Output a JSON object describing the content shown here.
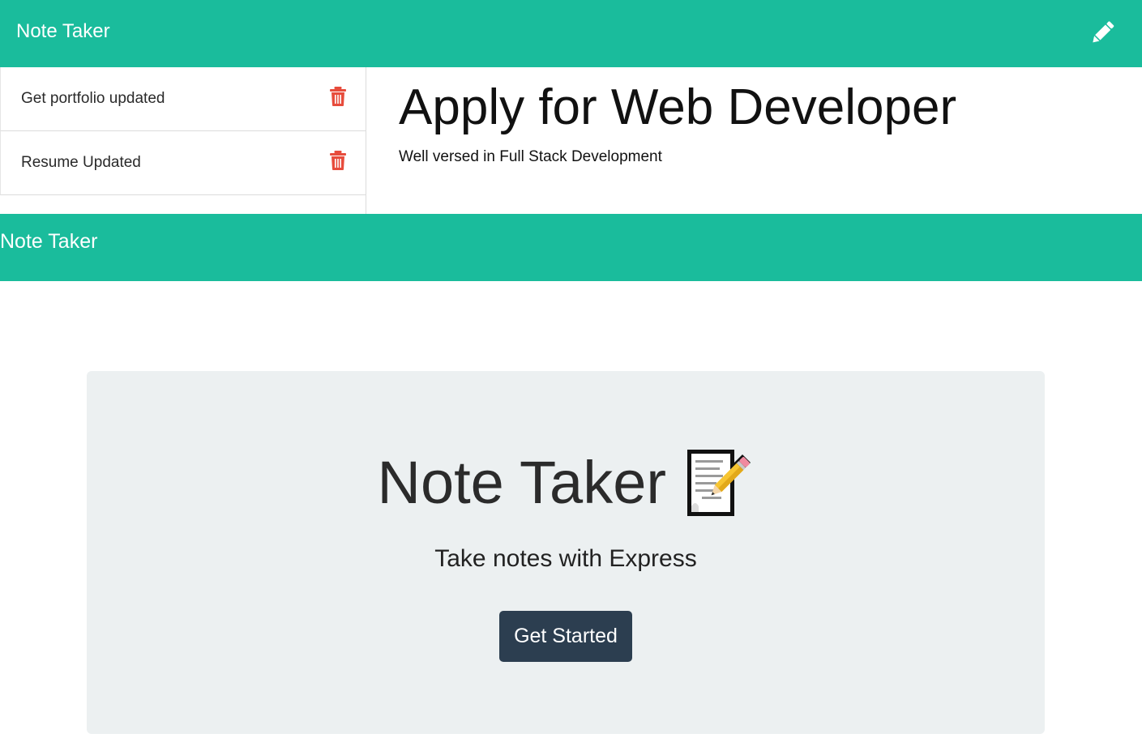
{
  "app": {
    "brand": "Note Taker"
  },
  "notes_list": [
    {
      "title": "Get portfolio updated"
    },
    {
      "title": "Resume Updated"
    }
  ],
  "active_note": {
    "title": "Apply for Web Developer",
    "text": "Well versed in Full Stack Development"
  },
  "landing": {
    "brand": "Note Taker",
    "heading": "Note Taker",
    "subheading": "Take notes with Express",
    "button_label": "Get Started"
  },
  "colors": {
    "accent": "#1abc9c",
    "button": "#2c3e50",
    "trash": "#e74c3c",
    "jumbotron_bg": "#ecf0f1"
  },
  "icons": {
    "edit": "pencil-icon",
    "delete": "trash-icon",
    "memo": "memo-icon"
  }
}
